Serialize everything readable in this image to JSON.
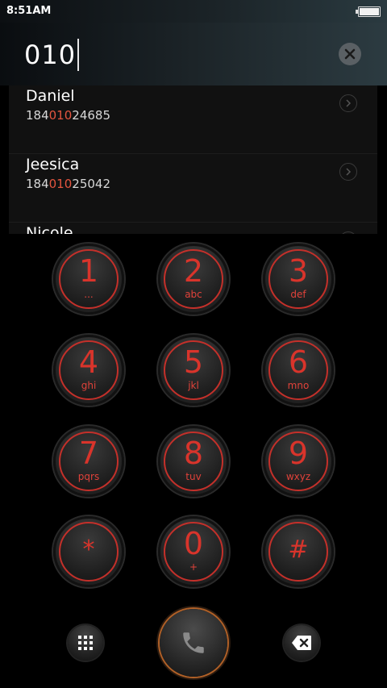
{
  "status": {
    "time": "8:51AM",
    "battery_level": 1.0
  },
  "input": {
    "value": "010"
  },
  "results": [
    {
      "name": "Daniel",
      "num_prefix": "184",
      "num_match": "010",
      "num_suffix": "24685"
    },
    {
      "name": "Jeesica",
      "num_prefix": "184",
      "num_match": "010",
      "num_suffix": "25042"
    },
    {
      "name": "Nicole",
      "num_prefix": "",
      "num_match": "",
      "num_suffix": ""
    }
  ],
  "keys": [
    {
      "digit": "1",
      "letters": "..."
    },
    {
      "digit": "2",
      "letters": "abc"
    },
    {
      "digit": "3",
      "letters": "def"
    },
    {
      "digit": "4",
      "letters": "ghi"
    },
    {
      "digit": "5",
      "letters": "jkl"
    },
    {
      "digit": "6",
      "letters": "mno"
    },
    {
      "digit": "7",
      "letters": "pqrs"
    },
    {
      "digit": "8",
      "letters": "tuv"
    },
    {
      "digit": "9",
      "letters": "wxyz"
    },
    {
      "digit": "*",
      "letters": ""
    },
    {
      "digit": "0",
      "letters": "+"
    },
    {
      "digit": "#",
      "letters": ""
    }
  ],
  "icons": {
    "clear": "close-icon",
    "chevron": "chevron-right-icon",
    "keypad": "grid-icon",
    "call": "phone-icon",
    "backspace": "backspace-icon"
  },
  "colors": {
    "accent": "#d9342b",
    "highlight": "#e4553f",
    "call_ring": "#b06027"
  }
}
